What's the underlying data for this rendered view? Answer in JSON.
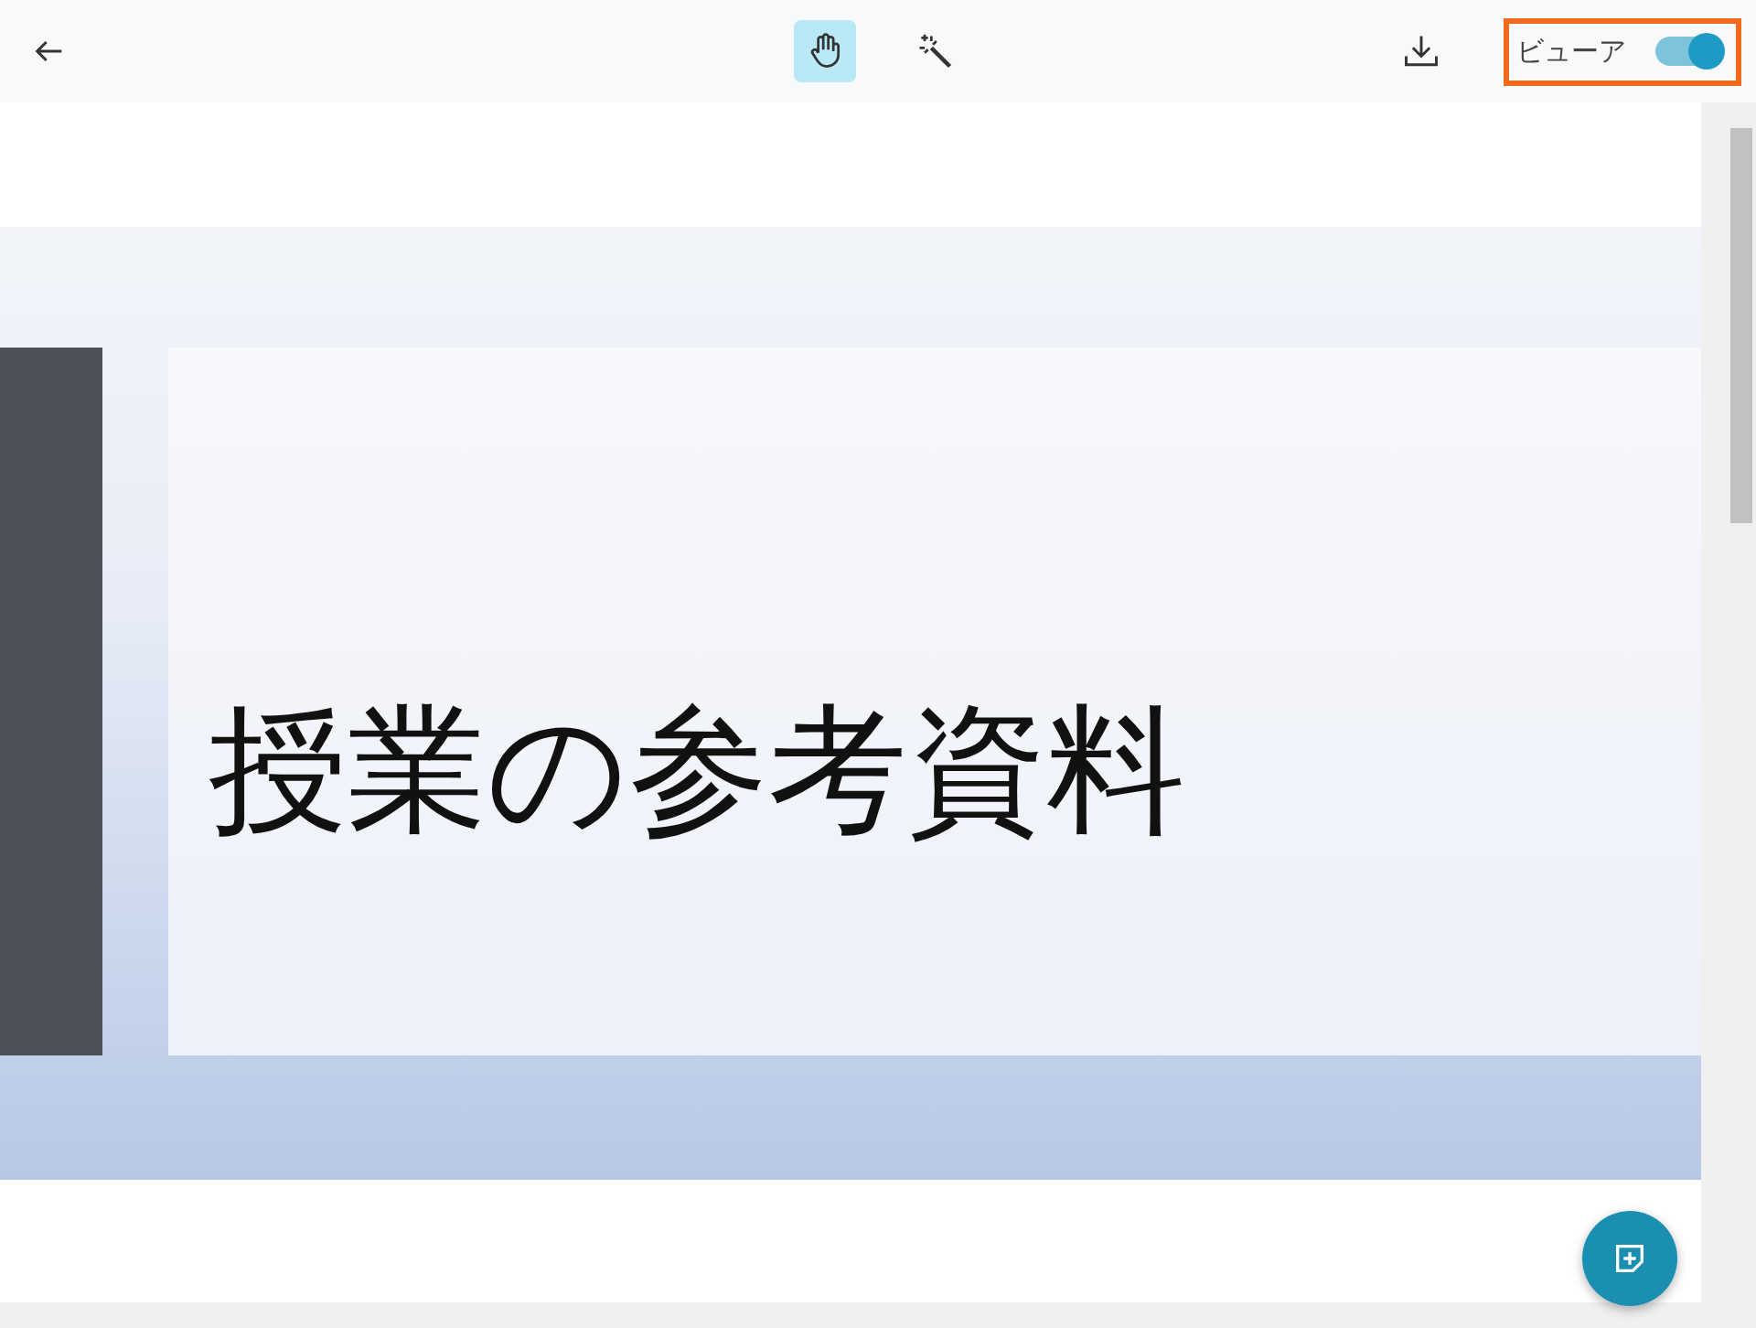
{
  "toolbar": {
    "tools": [
      {
        "kind": "hand",
        "selected": true
      },
      {
        "kind": "wand",
        "selected": false
      }
    ],
    "viewer": {
      "label": "ビューア",
      "on": true,
      "highlighted": true
    }
  },
  "slide": {
    "title": "授業の参考資料"
  }
}
